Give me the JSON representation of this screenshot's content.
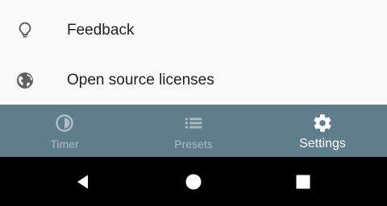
{
  "settings_list": {
    "items": [
      {
        "label": "Feedback",
        "icon": "lightbulb-icon"
      },
      {
        "label": "Open source licenses",
        "icon": "globe-icon"
      }
    ]
  },
  "bottom_nav": {
    "items": [
      {
        "label": "Timer",
        "icon": "timer-icon",
        "active": false
      },
      {
        "label": "Presets",
        "icon": "list-icon",
        "active": false
      },
      {
        "label": "Settings",
        "icon": "gear-icon",
        "active": true
      }
    ],
    "background_color": "#607d8b",
    "active_color": "#ffffff",
    "inactive_color": "#a9bcc6"
  },
  "system_nav": {
    "buttons": [
      {
        "name": "back",
        "icon": "back-triangle-icon"
      },
      {
        "name": "home",
        "icon": "home-circle-icon"
      },
      {
        "name": "recents",
        "icon": "recents-square-icon"
      }
    ]
  }
}
